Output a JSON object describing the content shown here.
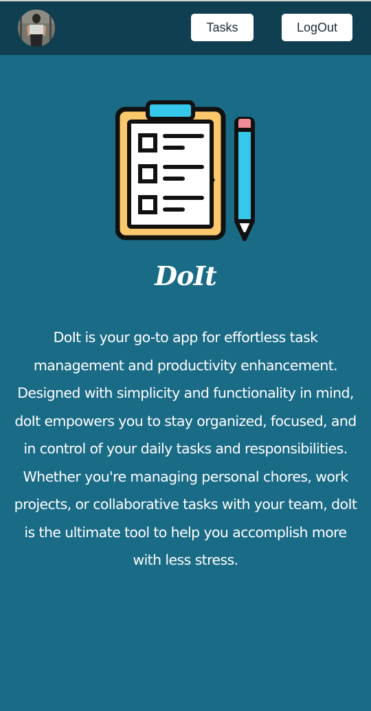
{
  "navbar": {
    "avatar_icon": "user-avatar-photo",
    "tasks_label": "Tasks",
    "logout_label": "LogOut"
  },
  "hero": {
    "icon": "clipboard-checklist-pencil-icon",
    "app_name": "DoIt",
    "description": "DoIt is your go-to app for effortless task management and productivity enhancement. Designed with simplicity and functionality in mind, doIt empowers you to stay organized, focused, and in control of your daily tasks and responsibilities. Whether you're managing personal chores, work projects, or collaborative tasks with your team, doIt is the ultimate tool to help you accomplish more with less stress."
  },
  "colors": {
    "background": "#1a6b86",
    "navbar": "#0f3f50",
    "button": "#ffffff",
    "clipboard_frame": "#fbc96b",
    "clipboard_clip": "#35c8ea",
    "pencil_body": "#35c8ea",
    "pencil_eraser": "#f08c95"
  }
}
